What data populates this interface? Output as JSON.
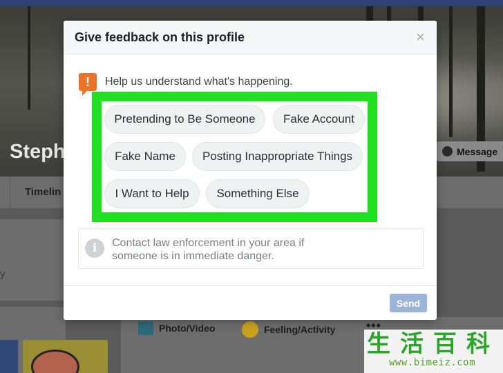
{
  "profile": {
    "name_partial": "Steph",
    "message_button": "Message",
    "tab_timeline_partial": "Timelin",
    "left_partial": "y"
  },
  "composer": {
    "photo_video": "Photo/Video",
    "feeling_activity": "Feeling/Activity",
    "more": "•••"
  },
  "modal": {
    "title": "Give feedback on this profile",
    "close_glyph": "×",
    "prompt": "Help us understand what's happening.",
    "alert_glyph": "!",
    "options": [
      "Pretending to Be Someone",
      "Fake Account",
      "Fake Name",
      "Posting Inappropriate Things",
      "I Want to Help",
      "Something Else"
    ],
    "info_glyph": "i",
    "info_text_line1": "Contact law enforcement in your area if",
    "info_text_line2": "someone is in immediate danger.",
    "send_label": "Send"
  },
  "colors": {
    "highlight": "#20e020",
    "send_button": "#9cb4d8",
    "alert_icon": "#e9742b"
  },
  "watermark": {
    "chars": [
      "生",
      "活",
      "百",
      "科"
    ],
    "url": "www.bimeiz.com"
  }
}
